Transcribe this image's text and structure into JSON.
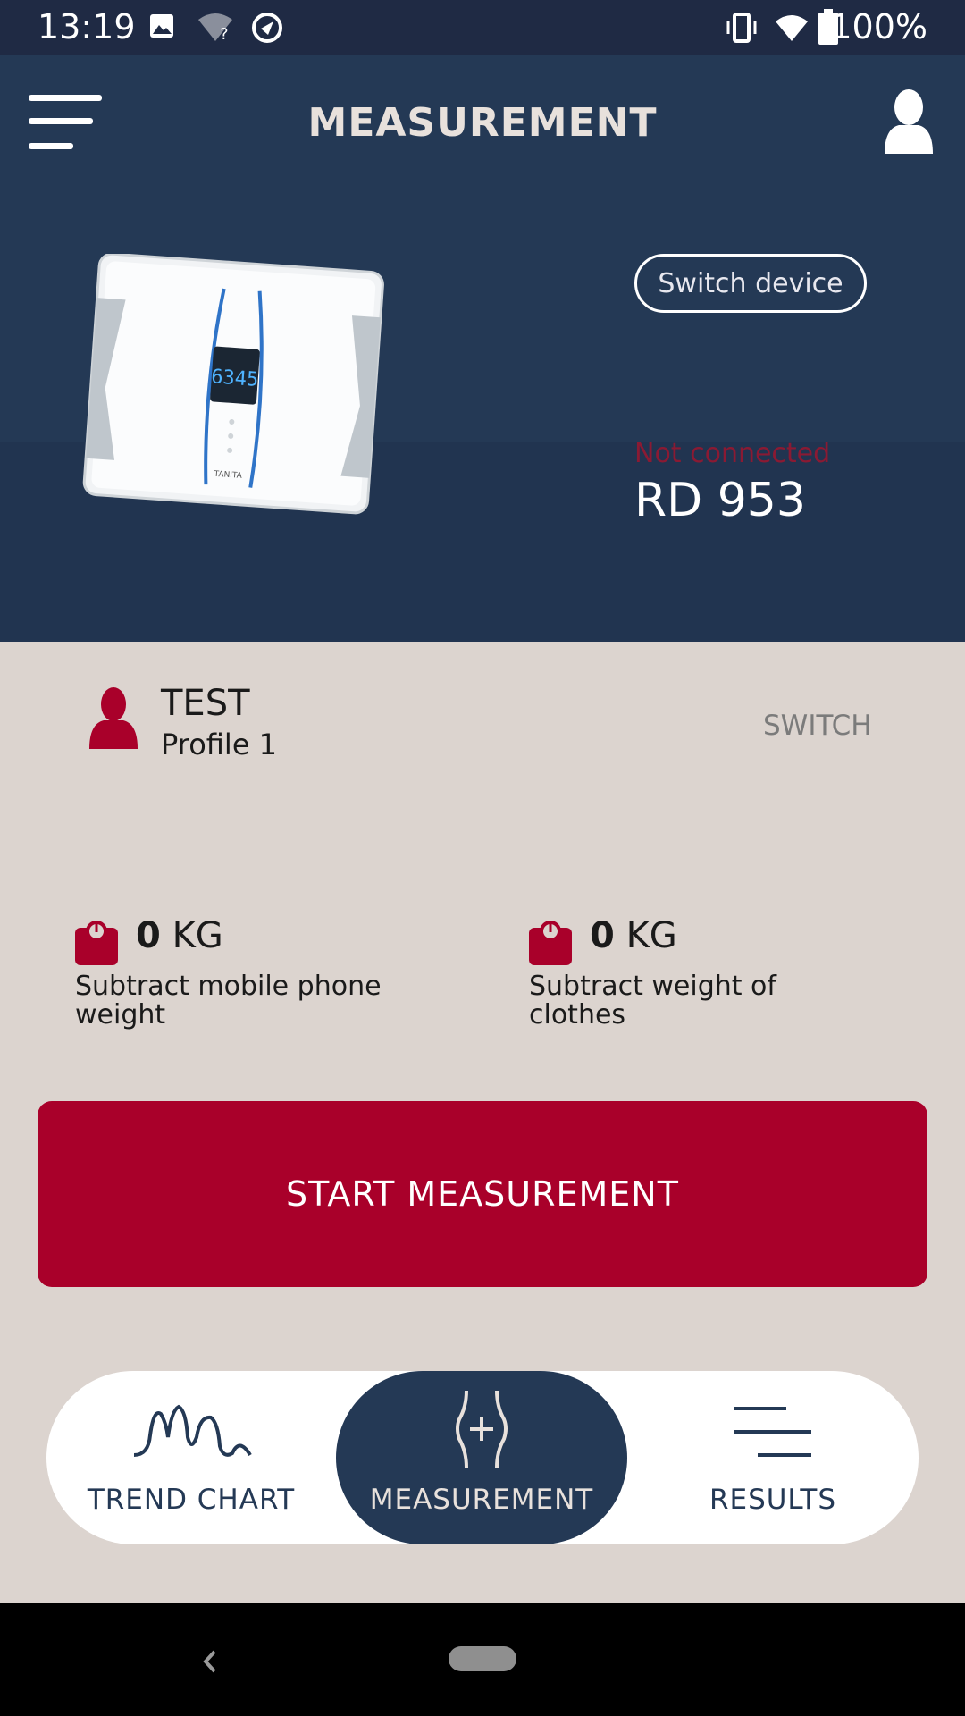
{
  "status_bar": {
    "time": "13:19",
    "battery": "100%",
    "icons": [
      "image-icon",
      "wifi-question-icon",
      "sync-icon",
      "vibrate-icon",
      "wifi-icon",
      "battery-icon"
    ]
  },
  "header": {
    "title": "MEASUREMENT",
    "menu_icon": "hamburger-icon",
    "profile_icon": "user-icon"
  },
  "device": {
    "switch_label": "Switch device",
    "status": "Not connected",
    "model": "RD 953",
    "scale_display": "6345",
    "brand": "TANITA"
  },
  "profile": {
    "name": "TEST",
    "subtitle": "Profile 1",
    "switch_label": "SWITCH"
  },
  "weights": [
    {
      "value": "0",
      "unit": "KG",
      "description": "Subtract mobile phone weight"
    },
    {
      "value": "0",
      "unit": "KG",
      "description": "Subtract weight of clothes"
    }
  ],
  "start_button": "START MEASUREMENT",
  "bottom_nav": {
    "items": [
      {
        "label": "TREND CHART",
        "icon": "trend-chart-icon"
      },
      {
        "label": "MEASUREMENT",
        "icon": "measurement-icon",
        "active": true
      },
      {
        "label": "RESULTS",
        "icon": "results-icon"
      }
    ]
  },
  "colors": {
    "header_bg": "#243955",
    "accent": "#a9002a",
    "page_bg": "#dcd4cf"
  }
}
